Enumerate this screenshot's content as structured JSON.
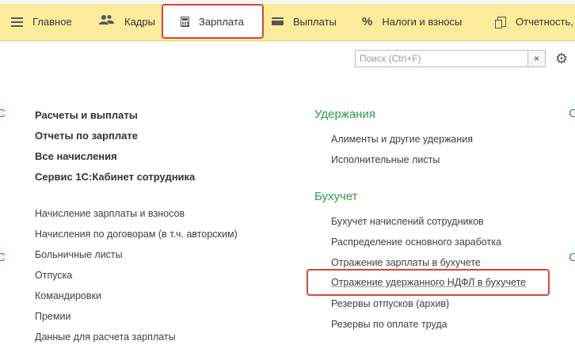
{
  "menubar": {
    "tabs": [
      {
        "label": "Главное",
        "icon": "menu-icon"
      },
      {
        "label": "Кадры",
        "icon": "people-icon"
      },
      {
        "label": "Зарплата",
        "icon": "calculator-icon",
        "active": true
      },
      {
        "label": "Выплаты",
        "icon": "card-icon"
      },
      {
        "label": "Налоги и взносы",
        "icon": "percent-icon"
      },
      {
        "label": "Отчетность, с",
        "icon": "report-icon"
      }
    ]
  },
  "search": {
    "placeholder": "Поиск (Ctrl+F)",
    "clear_label": "×",
    "settings_icon": "gear-icon"
  },
  "left_column": {
    "bold_links": [
      "Расчеты и выплаты",
      "Отчеты по зарплате",
      "Все начисления",
      "Сервис 1С:Кабинет сотрудника"
    ],
    "links": [
      "Начисление зарплаты и взносов",
      "Начисления по договорам (в т.ч. авторским)",
      "Больничные листы",
      "Отпуска",
      "Командировки",
      "Премии",
      "Данные для расчета зарплаты"
    ]
  },
  "right_column": {
    "deductions": {
      "title": "Удержания",
      "links": [
        "Алименты и другие удержания",
        "Исполнительные листы"
      ]
    },
    "accounting": {
      "title": "Бухучет",
      "links": [
        "Бухучет начислений сотрудников",
        "Распределение основного заработка",
        "Отражение зарплаты в бухучете",
        "Отражение удержанного НДФЛ в бухучете",
        "Резервы отпусков (архив)",
        "Резервы по оплате труда"
      ]
    }
  },
  "edge_glyphs": {
    "left_top": "С",
    "left_bottom": "С",
    "right_top": "С",
    "right_bottom": "С"
  },
  "colors": {
    "menubar": "#fbec9b",
    "section_header": "#2f9a4b",
    "highlight": "#d9453b"
  }
}
